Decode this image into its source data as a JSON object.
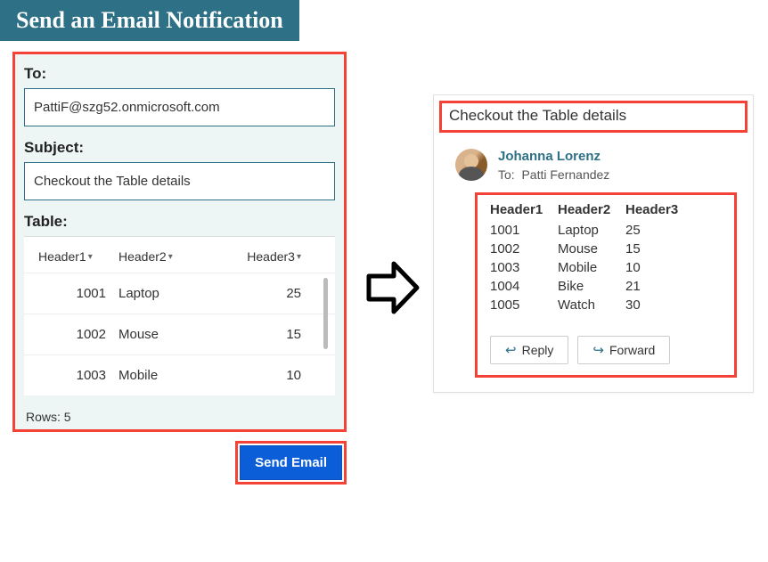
{
  "title": "Send an Email Notification",
  "form": {
    "to_label": "To:",
    "to_value": "PattiF@szg52.onmicrosoft.com",
    "subject_label": "Subject:",
    "subject_value": "Checkout the Table details",
    "table_label": "Table:"
  },
  "table": {
    "headers": [
      "Header1",
      "Header2",
      "Header3"
    ],
    "rows": [
      {
        "c1": "1001",
        "c2": "Laptop",
        "c3": "25"
      },
      {
        "c1": "1002",
        "c2": "Mouse",
        "c3": "15"
      },
      {
        "c1": "1003",
        "c2": "Mobile",
        "c3": "10"
      }
    ],
    "rows_info": "Rows: 5"
  },
  "send_button": "Send Email",
  "email": {
    "subject": "Checkout the Table details",
    "sender": "Johanna Lorenz",
    "to_label": "To:",
    "to_name": "Patti Fernandez",
    "headers": [
      "Header1",
      "Header2",
      "Header3"
    ],
    "rows": [
      {
        "c1": "1001",
        "c2": "Laptop",
        "c3": "25"
      },
      {
        "c1": "1002",
        "c2": "Mouse",
        "c3": "15"
      },
      {
        "c1": "1003",
        "c2": "Mobile",
        "c3": "10"
      },
      {
        "c1": "1004",
        "c2": "Bike",
        "c3": "21"
      },
      {
        "c1": "1005",
        "c2": "Watch",
        "c3": "30"
      }
    ],
    "reply": "Reply",
    "forward": "Forward"
  }
}
